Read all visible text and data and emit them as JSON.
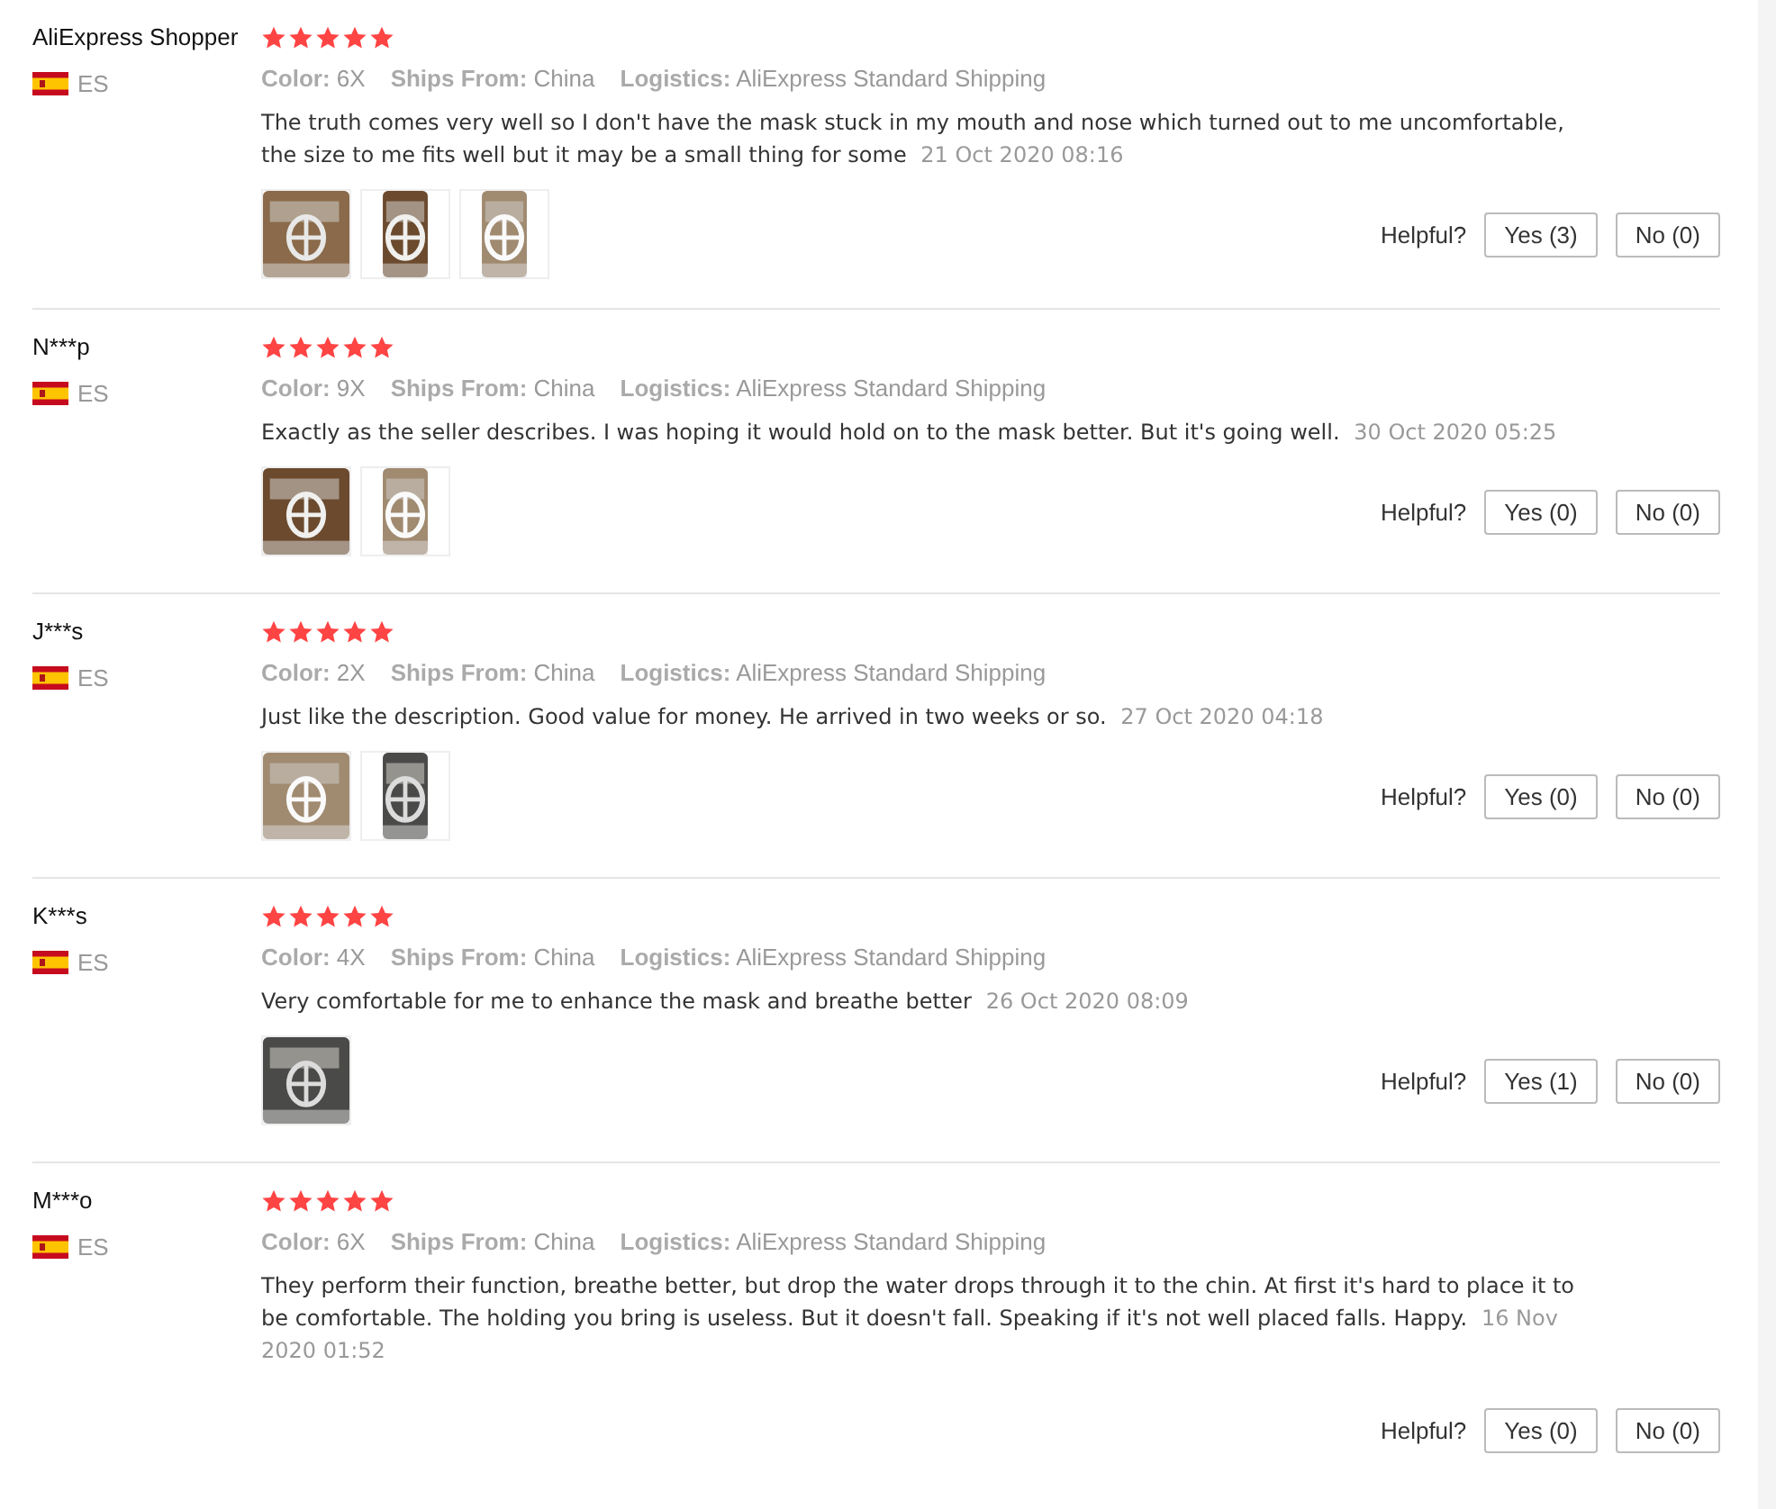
{
  "reviews": [
    {
      "name": "AliExpress Shopper",
      "country": "ES",
      "stars": 5,
      "meta": [
        {
          "label": "Color:",
          "value": "6X"
        },
        {
          "label": "Ships From:",
          "value": "China"
        },
        {
          "label": "Logistics:",
          "value": "AliExpress Standard Shipping"
        }
      ],
      "comment": "The truth comes very well so I don't have the mask stuck in my mouth and nose which turned out to me uncomfortable, the size to me fits well but it may be a small thing for some",
      "date": "21 Oct 2020 08:16",
      "photos": [
        {
          "kind": "picture"
        },
        {
          "kind": "picture"
        },
        {
          "kind": "picture"
        }
      ],
      "helpful_label": "Helpful?",
      "yes": "Yes (3)",
      "no": "No (0)"
    },
    {
      "name": "N***p",
      "country": "ES",
      "stars": 5,
      "meta": [
        {
          "label": "Color:",
          "value": "9X"
        },
        {
          "label": "Ships From:",
          "value": "China"
        },
        {
          "label": "Logistics:",
          "value": "AliExpress Standard Shipping"
        }
      ],
      "comment": "Exactly as the seller describes. I was hoping it would hold on to the mask better. But it's going well.",
      "date": "30 Oct 2020 05:25",
      "photos": [
        {
          "kind": "picture"
        },
        {
          "kind": "picture"
        }
      ],
      "helpful_label": "Helpful?",
      "yes": "Yes (0)",
      "no": "No (0)"
    },
    {
      "name": "J***s",
      "country": "ES",
      "stars": 5,
      "meta": [
        {
          "label": "Color:",
          "value": "2X"
        },
        {
          "label": "Ships From:",
          "value": "China"
        },
        {
          "label": "Logistics:",
          "value": "AliExpress Standard Shipping"
        }
      ],
      "comment": "Just like the description. Good value for money. He arrived in two weeks or so.",
      "date": "27 Oct 2020 04:18",
      "photos": [
        {
          "kind": "picture"
        },
        {
          "kind": "picture"
        }
      ],
      "helpful_label": "Helpful?",
      "yes": "Yes (0)",
      "no": "No (0)"
    },
    {
      "name": "K***s",
      "country": "ES",
      "stars": 5,
      "meta": [
        {
          "label": "Color:",
          "value": "4X"
        },
        {
          "label": "Ships From:",
          "value": "China"
        },
        {
          "label": "Logistics:",
          "value": "AliExpress Standard Shipping"
        }
      ],
      "comment": "Very comfortable for me to enhance the mask and breathe better",
      "date": "26 Oct 2020 08:09",
      "photos": [
        {
          "kind": "picture"
        }
      ],
      "helpful_label": "Helpful?",
      "yes": "Yes (1)",
      "no": "No (0)"
    },
    {
      "name": "M***o",
      "country": "ES",
      "stars": 5,
      "meta": [
        {
          "label": "Color:",
          "value": "6X"
        },
        {
          "label": "Ships From:",
          "value": "China"
        },
        {
          "label": "Logistics:",
          "value": "AliExpress Standard Shipping"
        }
      ],
      "comment": "They perform their function, breathe better, but drop the water drops through it to the chin. At first it's hard to place it to be comfortable. The holding you bring is useless. But it doesn't fall. Speaking if it's not well placed falls. Happy.",
      "date": "16 Nov 2020 01:52",
      "helpful_label": "Helpful?",
      "yes": "Yes (0)",
      "no": "No (0)"
    }
  ]
}
